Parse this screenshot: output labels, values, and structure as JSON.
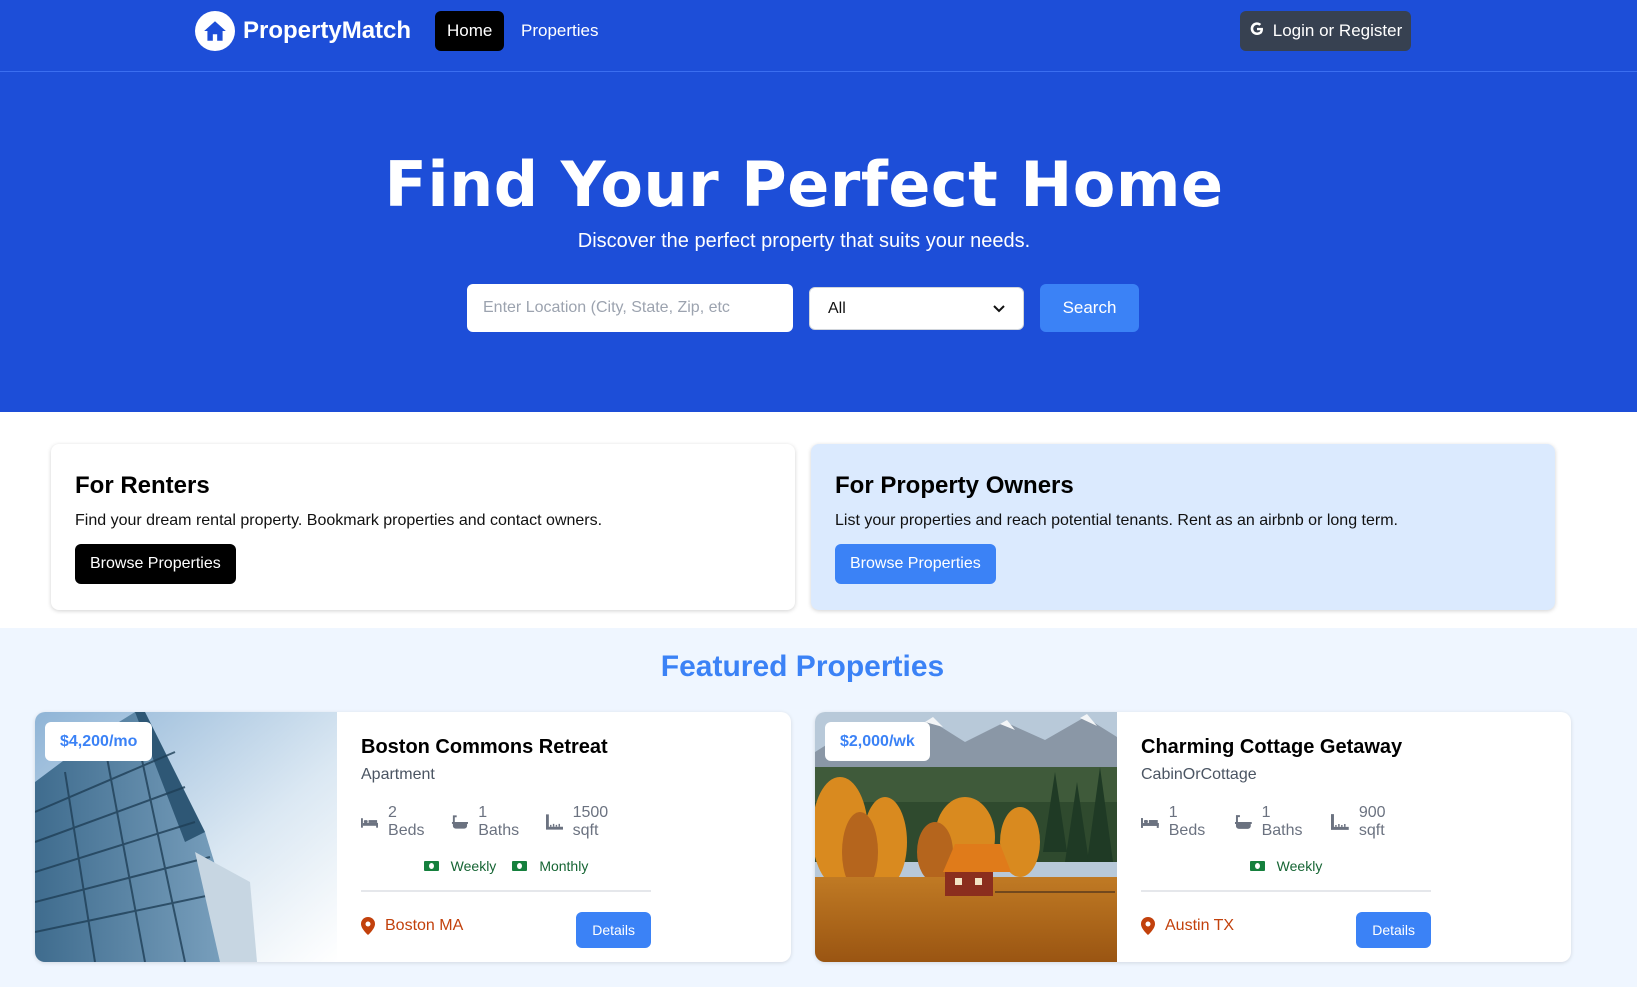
{
  "nav": {
    "brand": "PropertyMatch",
    "links": [
      "Home",
      "Properties"
    ],
    "login_label": "Login or Register"
  },
  "hero": {
    "title": "Find Your Perfect Home",
    "subtitle": "Discover the perfect property that suits your needs.",
    "location_placeholder": "Enter Location (City, State, Zip, etc",
    "type_selected": "All",
    "search_label": "Search"
  },
  "info": {
    "renters": {
      "title": "For Renters",
      "text": "Find your dream rental property. Bookmark properties and contact owners.",
      "button": "Browse Properties"
    },
    "owners": {
      "title": "For Property Owners",
      "text": "List your properties and reach potential tenants. Rent as an airbnb or long term.",
      "button": "Browse Properties"
    }
  },
  "featured": {
    "title": "Featured Properties",
    "properties": [
      {
        "price": "$4,200/mo",
        "name": "Boston Commons Retreat",
        "type": "Apartment",
        "beds": "2 Beds",
        "baths": "1 Baths",
        "sqft": "1500 sqft",
        "rates": [
          "Weekly",
          "Monthly"
        ],
        "location": "Boston MA",
        "details_label": "Details"
      },
      {
        "price": "$2,000/wk",
        "name": "Charming Cottage Getaway",
        "type": "CabinOrCottage",
        "beds": "1 Beds",
        "baths": "1 Baths",
        "sqft": "900 sqft",
        "rates": [
          "Weekly"
        ],
        "location": "Austin TX",
        "details_label": "Details"
      }
    ]
  },
  "colors": {
    "primary": "#1d4ed8",
    "accent": "#3b82f6",
    "location": "#c2410c",
    "rate": "#166534"
  }
}
